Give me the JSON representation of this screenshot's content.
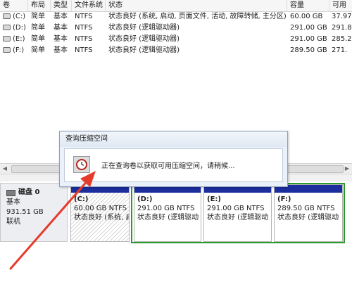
{
  "volume_table": {
    "columns": [
      "卷",
      "布局",
      "类型",
      "文件系统",
      "状态",
      "容量",
      "可用"
    ],
    "rows": [
      {
        "volume": "(C:)",
        "layout": "简单",
        "type": "基本",
        "fs": "NTFS",
        "status": "状态良好 (系统, 启动, 页面文件, 活动, 故障转储, 主分区)",
        "capacity": "60.00 GB",
        "free": "37.97"
      },
      {
        "volume": "(D:)",
        "layout": "简单",
        "type": "基本",
        "fs": "NTFS",
        "status": "状态良好 (逻辑驱动器)",
        "capacity": "291.00 GB",
        "free": "291.8"
      },
      {
        "volume": "(E:)",
        "layout": "简单",
        "type": "基本",
        "fs": "NTFS",
        "status": "状态良好 (逻辑驱动器)",
        "capacity": "291.00 GB",
        "free": "285.2"
      },
      {
        "volume": "(F:)",
        "layout": "简单",
        "type": "基本",
        "fs": "NTFS",
        "status": "状态良好 (逻辑驱动器)",
        "capacity": "289.50 GB",
        "free": "271."
      }
    ]
  },
  "scrollbar": {
    "left_arrow": "◀",
    "right_arrow": "▶"
  },
  "disk": {
    "name": "磁盘 0",
    "type": "基本",
    "size": "931.51 GB",
    "state": "联机"
  },
  "partitions": [
    {
      "name": "(C:)",
      "size": "60.00 GB NTFS",
      "status": "状态良好 (系统, 启"
    },
    {
      "name": "(D:)",
      "size": "291.00 GB NTFS",
      "status": "状态良好 (逻辑驱动"
    },
    {
      "name": "(E:)",
      "size": "291.00 GB NTFS",
      "status": "状态良好 (逻辑驱动"
    },
    {
      "name": "(F:)",
      "size": "289.50 GB NTFS",
      "status": "状态良好 (逻辑驱动"
    }
  ],
  "dialog": {
    "title": "查询压缩空间",
    "message": "正在查询卷以获取可用压缩空间，请稍候..."
  },
  "colors": {
    "primary_partition_bar": "#1c2e9e",
    "extended_outline": "#2d9a2d",
    "annotation_arrow": "#e53b2c"
  }
}
